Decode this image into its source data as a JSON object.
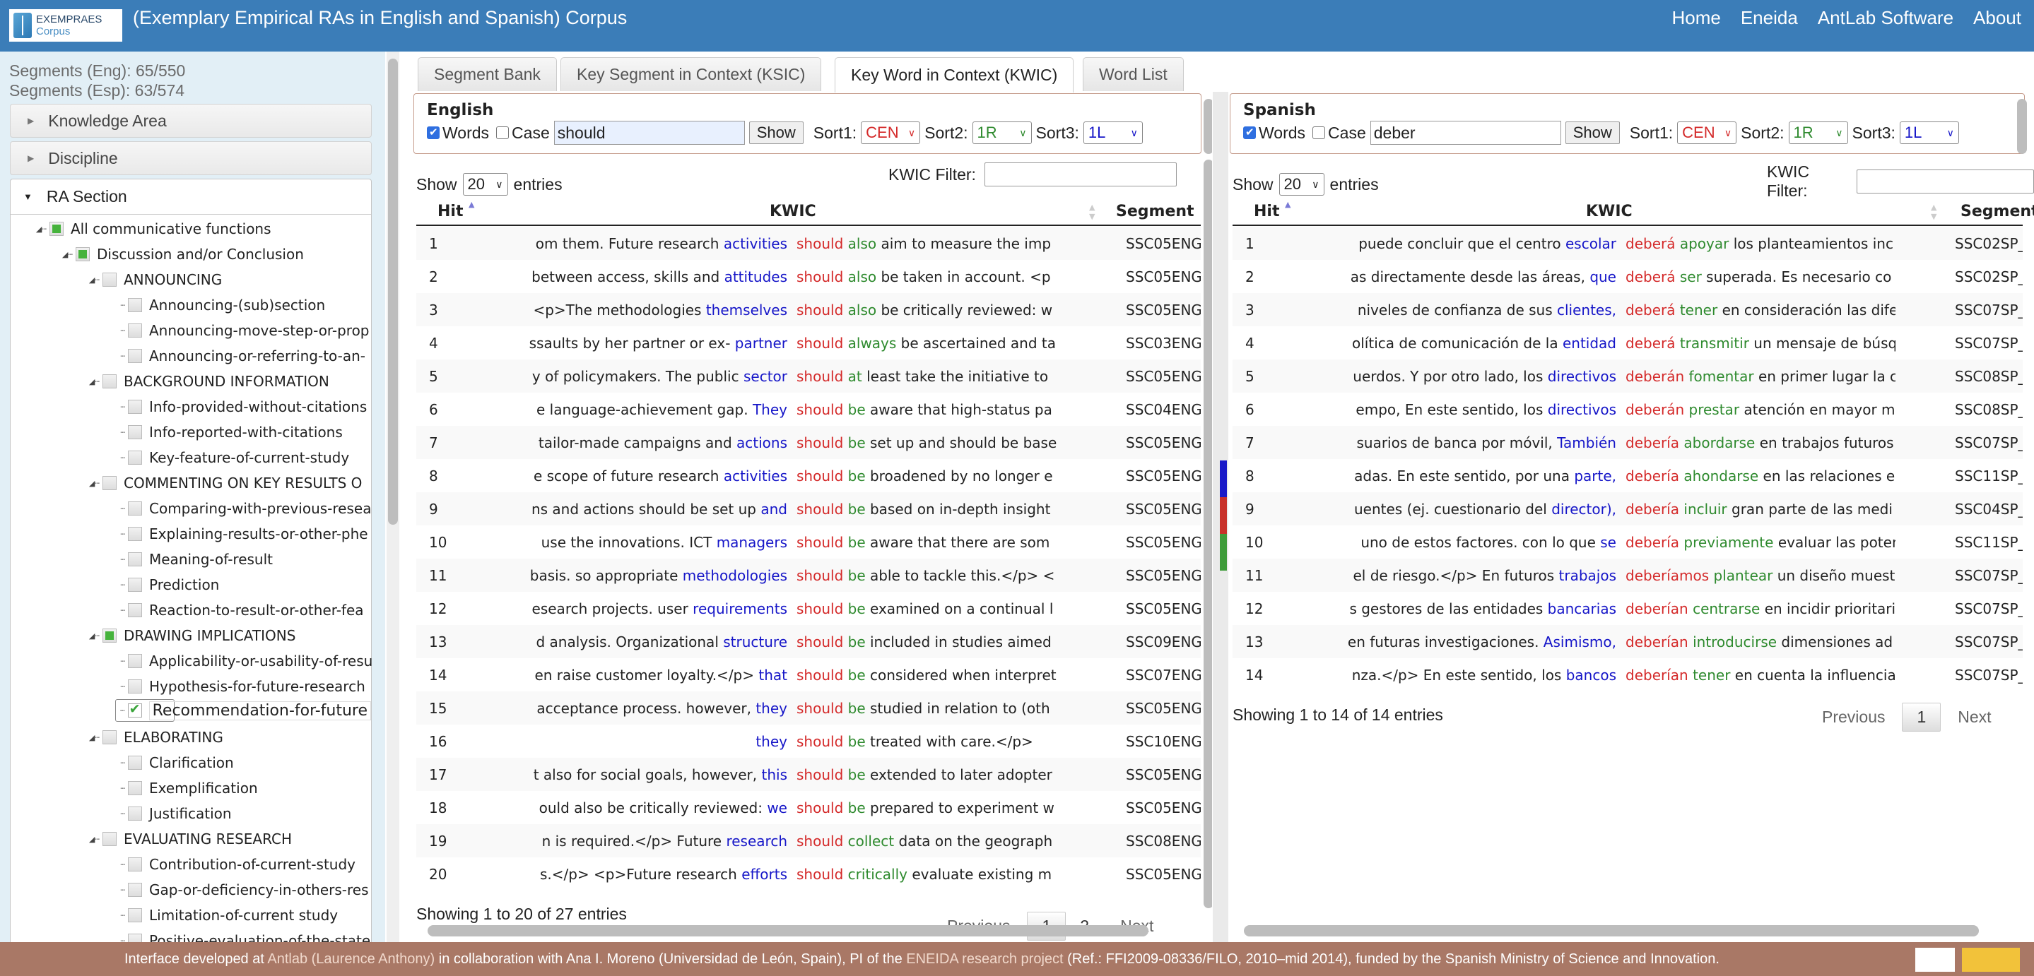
{
  "header": {
    "logo_text": "EXEMPRAES",
    "logo_sub": "Corpus",
    "title": "(Exemplary Empirical RAs in English and Spanish) Corpus",
    "nav": [
      "Home",
      "Eneida",
      "AntLab Software",
      "About"
    ],
    "color": "#3b7db8"
  },
  "sidebar": {
    "seg_eng": "Segments (Eng): 65/550",
    "seg_esp": "Segments (Esp): 63/574",
    "accordions": [
      "Knowledge Area",
      "Discipline"
    ],
    "ra_section": "RA Section",
    "tree": [
      {
        "level": 0,
        "label": "All communicative functions",
        "state": "partial"
      },
      {
        "level": 1,
        "label": "Discussion and/or Conclusion",
        "state": "partial"
      },
      {
        "level": 2,
        "label": "ANNOUNCING",
        "state": "none"
      },
      {
        "level": 3,
        "label": "Announcing-(sub)section",
        "state": "none"
      },
      {
        "level": 3,
        "label": "Announcing-move-step-or-prop",
        "state": "none"
      },
      {
        "level": 3,
        "label": "Announcing-or-referring-to-an-",
        "state": "none"
      },
      {
        "level": 2,
        "label": "BACKGROUND INFORMATION",
        "state": "none"
      },
      {
        "level": 3,
        "label": "Info-provided-without-citations",
        "state": "none"
      },
      {
        "level": 3,
        "label": "Info-reported-with-citations",
        "state": "none"
      },
      {
        "level": 3,
        "label": "Key-feature-of-current-study",
        "state": "none"
      },
      {
        "level": 2,
        "label": "COMMENTING ON KEY RESULTS O",
        "state": "none"
      },
      {
        "level": 3,
        "label": "Comparing-with-previous-resea",
        "state": "none"
      },
      {
        "level": 3,
        "label": "Explaining-results-or-other-phe",
        "state": "none"
      },
      {
        "level": 3,
        "label": "Meaning-of-result",
        "state": "none"
      },
      {
        "level": 3,
        "label": "Prediction",
        "state": "none"
      },
      {
        "level": 3,
        "label": "Reaction-to-result-or-other-fea",
        "state": "none"
      },
      {
        "level": 2,
        "label": "DRAWING IMPLICATIONS",
        "state": "partial"
      },
      {
        "level": 3,
        "label": "Applicability-or-usability-of-resu",
        "state": "none"
      },
      {
        "level": 3,
        "label": "Hypothesis-for-future-research",
        "state": "none"
      },
      {
        "level": 3,
        "label": "Recommendation-for-future",
        "state": "checked"
      },
      {
        "level": 2,
        "label": "ELABORATING",
        "state": "none"
      },
      {
        "level": 3,
        "label": "Clarification",
        "state": "none"
      },
      {
        "level": 3,
        "label": "Exemplification",
        "state": "none"
      },
      {
        "level": 3,
        "label": "Justification",
        "state": "none"
      },
      {
        "level": 2,
        "label": "EVALUATING RESEARCH",
        "state": "none"
      },
      {
        "level": 3,
        "label": "Contribution-of-current-study",
        "state": "none"
      },
      {
        "level": 3,
        "label": "Gap-or-deficiency-in-others-res",
        "state": "none"
      },
      {
        "level": 3,
        "label": "Limitation-of-current study",
        "state": "none"
      },
      {
        "level": 3,
        "label": "Positive-evaluation-of-the-state",
        "state": "none"
      }
    ]
  },
  "tabs": [
    "Segment Bank",
    "Key Segment in Context (KSIC)",
    "Key Word in Context (KWIC)",
    "Word List"
  ],
  "active_tab": "Key Word in Context (KWIC)",
  "panels": [
    {
      "language": "English",
      "words_label": "Words",
      "words_checked": true,
      "case_label": "Case",
      "case_checked": false,
      "query": "should",
      "show_button": "Show",
      "sort1_label": "Sort1:",
      "sort1": "CEN",
      "sort2_label": "Sort2:",
      "sort2": "1R",
      "sort3_label": "Sort3:",
      "sort3": "1L",
      "show_label": "Show",
      "entries_value": "20",
      "entries_label": "entries",
      "filter_label": "KWIC Filter:",
      "filter_value": "",
      "columns": [
        "Hit",
        "KWIC",
        "Segment"
      ],
      "rows": [
        {
          "hit": "1",
          "left": "om them. Future research",
          "l1": "activities",
          "node": "should",
          "r1": "also",
          "right": "aim to measure the imp",
          "segment": "SSC05ENG_"
        },
        {
          "hit": "2",
          "left": "between access, skills and",
          "l1": "attitudes",
          "node": "should",
          "r1": "also",
          "right": "be taken in account. <p",
          "segment": "SSC05ENG_"
        },
        {
          "hit": "3",
          "left": "<p>The methodologies",
          "l1": "themselves",
          "node": "should",
          "r1": "also",
          "right": "be critically reviewed: w",
          "segment": "SSC05ENG_"
        },
        {
          "hit": "4",
          "left": "ssaults by her partner or ex-",
          "l1": "partner",
          "node": "should",
          "r1": "always",
          "right": "be ascertained and ta",
          "segment": "SSC03ENG_"
        },
        {
          "hit": "5",
          "left": "y of policymakers. The public",
          "l1": "sector",
          "node": "should",
          "r1": "at",
          "right": "least take the initiative to",
          "segment": "SSC05ENG_"
        },
        {
          "hit": "6",
          "left": "e language-achievement gap.",
          "l1": "They",
          "node": "should",
          "r1": "be",
          "right": "aware that high-status pa",
          "segment": "SSC04ENG_"
        },
        {
          "hit": "7",
          "left": "tailor-made campaigns and",
          "l1": "actions",
          "node": "should",
          "r1": "be",
          "right": "set up and should be base",
          "segment": "SSC05ENG_"
        },
        {
          "hit": "8",
          "left": "e scope of future research",
          "l1": "activities",
          "node": "should",
          "r1": "be",
          "right": "broadened by no longer e",
          "segment": "SSC05ENG_"
        },
        {
          "hit": "9",
          "left": "ns and actions should be set up",
          "l1": "and",
          "node": "should",
          "r1": "be",
          "right": "based on in-depth insight",
          "segment": "SSC05ENG_"
        },
        {
          "hit": "10",
          "left": "use the innovations. ICT",
          "l1": "managers",
          "node": "should",
          "r1": "be",
          "right": "aware that there are som",
          "segment": "SSC05ENG_"
        },
        {
          "hit": "11",
          "left": "basis. so appropriate",
          "l1": "methodologies",
          "node": "should",
          "r1": "be",
          "right": "able to tackle this.</p> <",
          "segment": "SSC05ENG_"
        },
        {
          "hit": "12",
          "left": "esearch projects. user",
          "l1": "requirements",
          "node": "should",
          "r1": "be",
          "right": "examined on a continual l",
          "segment": "SSC05ENG_"
        },
        {
          "hit": "13",
          "left": "d analysis. Organizational",
          "l1": "structure",
          "node": "should",
          "r1": "be",
          "right": "included in studies aimed",
          "segment": "SSC09ENG_"
        },
        {
          "hit": "14",
          "left": "en raise customer loyalty.</p>",
          "l1": "that",
          "node": "should",
          "r1": "be",
          "right": "considered when interpret",
          "segment": "SSC07ENG_"
        },
        {
          "hit": "15",
          "left": "acceptance process. however,",
          "l1": "they",
          "node": "should",
          "r1": "be",
          "right": "studied in relation to (oth",
          "segment": "SSC05ENG_"
        },
        {
          "hit": "16",
          "left": "",
          "l1": "they",
          "node": "should",
          "r1": "be",
          "right": "treated with care.</p>",
          "segment": "SSC10ENG_"
        },
        {
          "hit": "17",
          "left": "t also for social goals, however,",
          "l1": "this",
          "node": "should",
          "r1": "be",
          "right": "extended to later adopter",
          "segment": "SSC05ENG_"
        },
        {
          "hit": "18",
          "left": "ould also be critically reviewed:",
          "l1": "we",
          "node": "should",
          "r1": "be",
          "right": "prepared to experiment w",
          "segment": "SSC05ENG_"
        },
        {
          "hit": "19",
          "left": "n is required.</p> Future",
          "l1": "research",
          "node": "should",
          "r1": "collect",
          "right": "data on the geograph",
          "segment": "SSC08ENG_"
        },
        {
          "hit": "20",
          "left": "s.</p> <p>Future research",
          "l1": "efforts",
          "node": "should",
          "r1": "critically",
          "right": "evaluate existing m",
          "segment": "SSC05ENG_"
        }
      ],
      "info": "Showing 1 to 20 of 27 entries",
      "pager": {
        "prev": "Previous",
        "pages": [
          "1",
          "2"
        ],
        "current": "1",
        "next": "Next"
      }
    },
    {
      "language": "Spanish",
      "words_label": "Words",
      "words_checked": true,
      "case_label": "Case",
      "case_checked": false,
      "query": "deber",
      "show_button": "Show",
      "sort1_label": "Sort1:",
      "sort1": "CEN",
      "sort2_label": "Sort2:",
      "sort2": "1R",
      "sort3_label": "Sort3:",
      "sort3": "1L",
      "show_label": "Show",
      "entries_value": "20",
      "entries_label": "entries",
      "filter_label": "KWIC Filter:",
      "filter_value": "",
      "columns": [
        "Hit",
        "KWIC",
        "Segment"
      ],
      "rows": [
        {
          "hit": "1",
          "left": "puede concluir que el centro",
          "l1": "escolar",
          "node": "deberá",
          "r1": "apoyar",
          "right": "los planteamientos inc",
          "segment": "SSC02SP_"
        },
        {
          "hit": "2",
          "left": "as directamente desde las áreas,",
          "l1": "que",
          "node": "deberá",
          "r1": "ser",
          "right": "superada. Es necesario co",
          "segment": "SSC02SP_"
        },
        {
          "hit": "3",
          "left": "niveles de confianza de sus",
          "l1": "clientes,",
          "node": "deberá",
          "r1": "tener",
          "right": "en consideración las dife",
          "segment": "SSC07SP_"
        },
        {
          "hit": "4",
          "left": "olítica de comunicación de la",
          "l1": "entidad",
          "node": "deberá",
          "r1": "transmitir",
          "right": "un mensaje de búsq",
          "segment": "SSC07SP_"
        },
        {
          "hit": "5",
          "left": "uerdos. Y por otro lado, los",
          "l1": "directivos",
          "node": "deberán",
          "r1": "fomentar",
          "right": "en primer lugar la c",
          "segment": "SSC08SP_"
        },
        {
          "hit": "6",
          "left": "empo, En este sentido, los",
          "l1": "directivos",
          "node": "deberán",
          "r1": "prestar",
          "right": "atención en mayor m",
          "segment": "SSC08SP_"
        },
        {
          "hit": "7",
          "left": "suarios de banca por móvil,",
          "l1": "También",
          "node": "debería",
          "r1": "abordarse",
          "right": "en trabajos futuros",
          "segment": "SSC07SP_"
        },
        {
          "hit": "8",
          "left": "adas. En este sentido, por una",
          "l1": "parte,",
          "node": "debería",
          "r1": "ahondarse",
          "right": "en las relaciones e",
          "segment": "SSC11SP_"
        },
        {
          "hit": "9",
          "left": "uentes (ej. cuestionario del",
          "l1": "director),",
          "node": "debería",
          "r1": "incluir",
          "right": "gran parte de las medi",
          "segment": "SSC04SP_"
        },
        {
          "hit": "10",
          "left": "uno de estos factores. con lo que",
          "l1": "se",
          "node": "debería",
          "r1": "previamente",
          "right": "evaluar las poten",
          "segment": "SSC11SP_"
        },
        {
          "hit": "11",
          "left": "el de riesgo.</p> En futuros",
          "l1": "trabajos",
          "node": "deberíamos",
          "r1": "plantear",
          "right": "un diseño muest",
          "segment": "SSC07SP_"
        },
        {
          "hit": "12",
          "left": "s gestores de las entidades",
          "l1": "bancarias",
          "node": "deberían",
          "r1": "centrarse",
          "right": "en incidir prioritari",
          "segment": "SSC07SP_"
        },
        {
          "hit": "13",
          "left": "en futuras investigaciones.",
          "l1": "Asimismo,",
          "node": "deberían",
          "r1": "introducirse",
          "right": "dimensiones ad",
          "segment": "SSC07SP_"
        },
        {
          "hit": "14",
          "left": "nza.</p> En este sentido, los",
          "l1": "bancos",
          "node": "deberían",
          "r1": "tener",
          "right": "en cuenta la influencia",
          "segment": "SSC07SP_"
        }
      ],
      "info": "Showing 1 to 14 of 14 entries",
      "pager": {
        "prev": "Previous",
        "pages": [
          "1"
        ],
        "current": "1",
        "next": "Next"
      }
    }
  ],
  "splitter_colors": [
    "#1a1ac8",
    "#c8312a",
    "#3f9c3a"
  ],
  "footer": {
    "pre": "Interface developed at ",
    "link1": "Antlab (Laurence Anthony)",
    "mid": " in collaboration with Ana I. Moreno (Universidad de León, Spain), PI of the ",
    "link2": "ENEIDA research project",
    "post": " (Ref.: FFI2009-08336/FILO, 2010–mid 2014), funded by the Spanish Ministry of Science and Innovation.",
    "color": "#a97866"
  }
}
